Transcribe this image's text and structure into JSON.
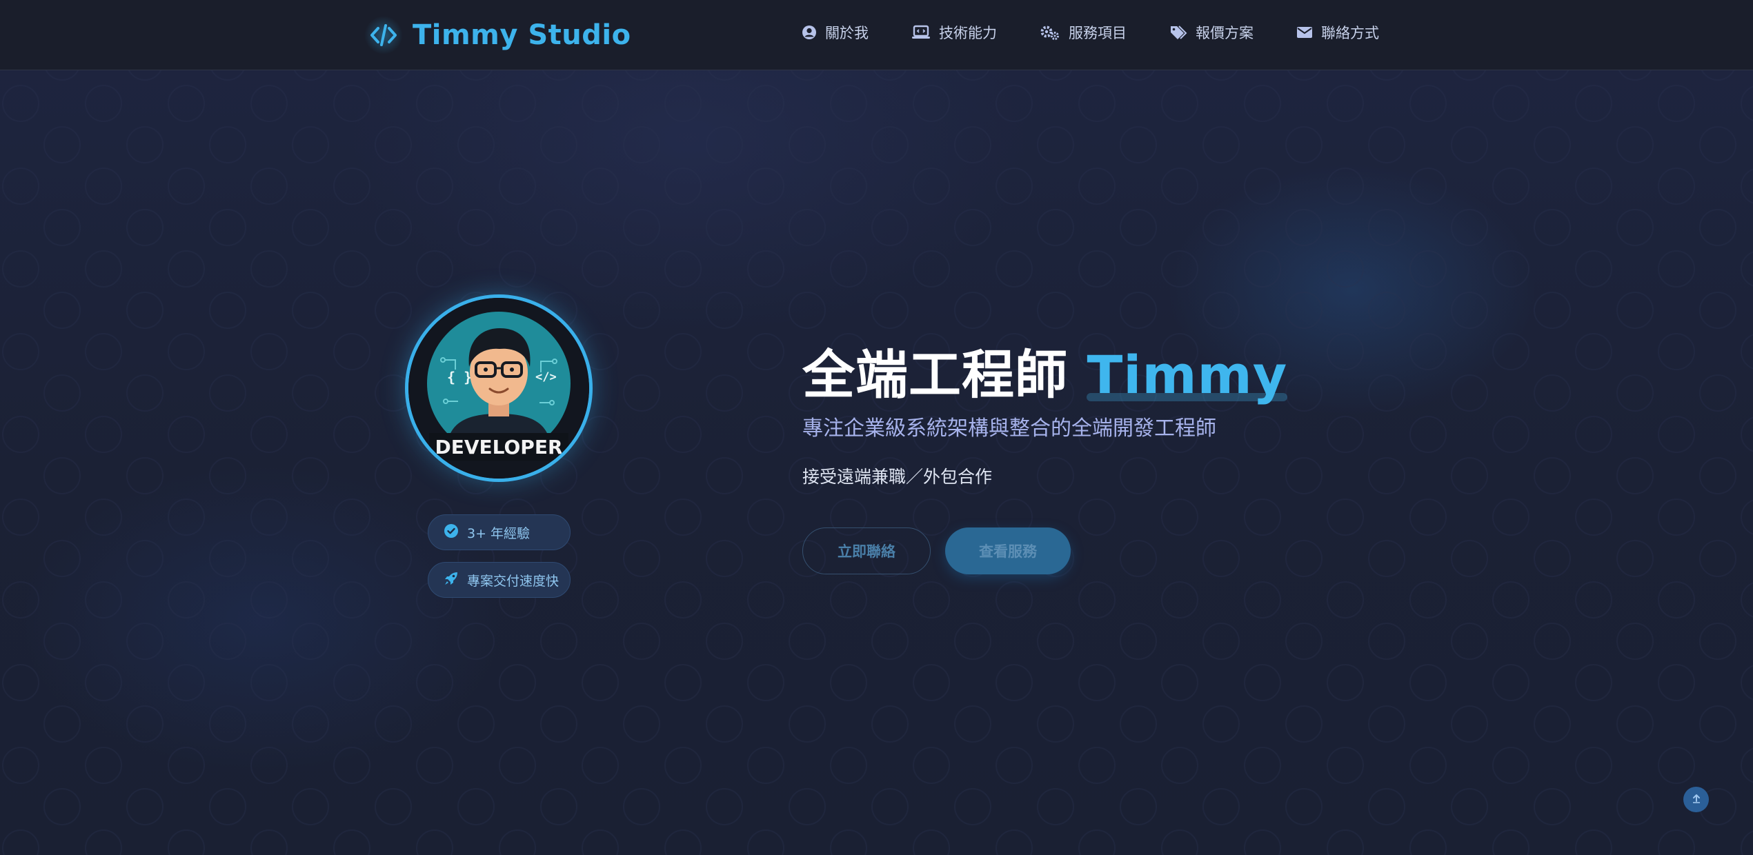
{
  "brand": {
    "icon": "code-icon",
    "name": "Timmy Studio"
  },
  "nav": {
    "items": [
      {
        "icon": "user-circle-icon",
        "label": "關於我"
      },
      {
        "icon": "laptop-code-icon",
        "label": "技術能力"
      },
      {
        "icon": "gears-icon",
        "label": "服務項目"
      },
      {
        "icon": "tags-icon",
        "label": "報價方案"
      },
      {
        "icon": "envelope-icon",
        "label": "聯絡方式"
      }
    ]
  },
  "hero": {
    "avatar_caption": "DEVELOPER",
    "badges": [
      {
        "icon": "check-circle-icon",
        "label": "3+ 年經驗"
      },
      {
        "icon": "rocket-icon",
        "label": "專案交付速度快"
      }
    ],
    "title_prefix": "全端工程師",
    "title_name": "Timmy",
    "subtitle": "專注企業級系統架構與整合的全端開發工程師",
    "note": "接受遠端兼職／外包合作",
    "primary_button": "立即聯絡",
    "secondary_button": "查看服務"
  },
  "back_to_top": {
    "icon": "arrow-up-icon"
  },
  "colors": {
    "accent": "#3db3ec",
    "background": "#1c2236",
    "header": "#1a1e2b"
  }
}
